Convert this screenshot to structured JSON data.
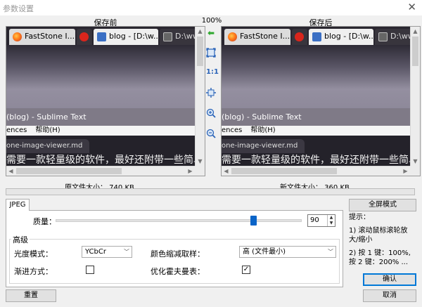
{
  "window": {
    "title": "参数设置",
    "close_glyph": "✕"
  },
  "panes": {
    "before_label": "保存前",
    "after_label": "保存后",
    "zoom": "100%",
    "before_size": "原文件大小： 740 KB",
    "after_size": "新文件大小： 360 KB"
  },
  "preview": {
    "tabs": [
      {
        "label": "FastStone I...",
        "icon": "firefox-icon"
      },
      {
        "label": "",
        "icon": "weibo-icon"
      },
      {
        "label": "blog - [D:\\w...",
        "icon": "sublime-icon"
      },
      {
        "label": "D:\\ww",
        "icon": "window-icon"
      }
    ],
    "window_title": "(blog) - Sublime Text",
    "menu": [
      "ences",
      "帮助(H)"
    ],
    "file_tab": "one-image-viewer.md",
    "content_line": "需要一款轻量级的软件，最好还附带一些简单"
  },
  "tools": {
    "copy_icon": "arrow-left-icon",
    "fit_icon": "fit-window-icon",
    "actual_label": "1:1",
    "center_icon": "move-icon",
    "zoom_in_icon": "zoom-in-icon",
    "zoom_out_icon": "zoom-out-icon"
  },
  "settings": {
    "tab": "JPEG",
    "quality_label": "质量：",
    "quality_value": "90",
    "quality_max": 100,
    "advanced_title": "高级",
    "luma_label": "光度模式：",
    "luma_value": "YCbCr",
    "chroma_label": "颜色缩减取样：",
    "chroma_value": "高 (文件最小)",
    "progressive_label": "渐进方式：",
    "progressive_checked": false,
    "huffman_label": "优化霍夫曼表：",
    "huffman_checked": true,
    "check_glyph": "✓"
  },
  "side": {
    "fullscreen": "全屏模式",
    "tips_title": "提示：",
    "tip1": "1) 滚动鼠标滚轮放大/缩小",
    "tip2": "2) 按 1 键：100%, 按 2 键：200% ..."
  },
  "buttons": {
    "reset": "重置",
    "ok": "确认",
    "cancel": "取消"
  },
  "colors": {
    "accent": "#0078d7",
    "slider": "#0a64c8"
  }
}
